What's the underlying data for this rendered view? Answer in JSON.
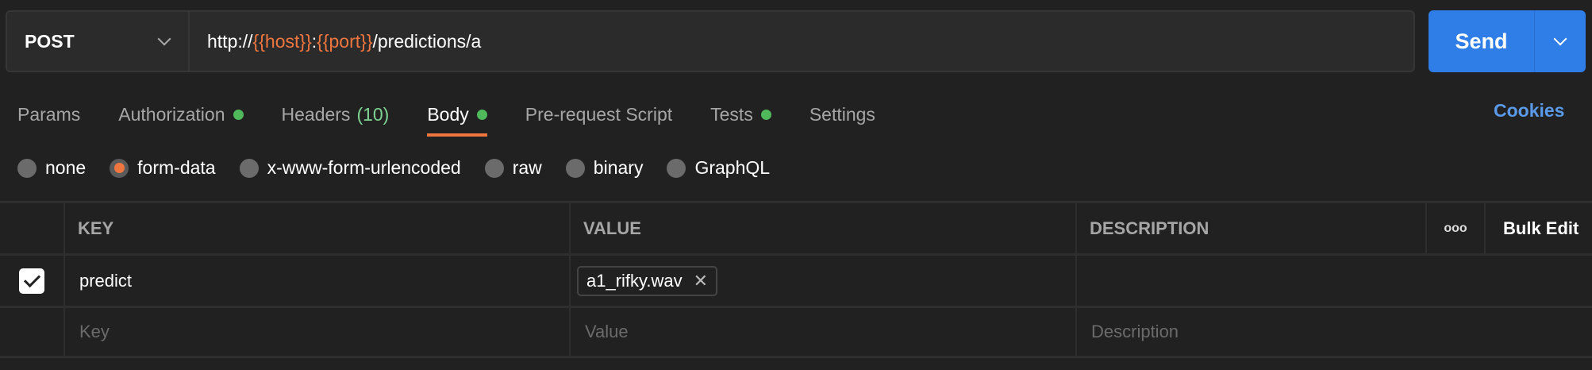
{
  "request": {
    "method": "POST",
    "url_parts": [
      {
        "t": "http://",
        "v": false
      },
      {
        "t": "{{host}}",
        "v": true
      },
      {
        "t": ":",
        "v": false
      },
      {
        "t": "{{port}}",
        "v": true
      },
      {
        "t": "/predictions/a",
        "v": false
      }
    ]
  },
  "send": {
    "label": "Send"
  },
  "tabs": [
    {
      "label": "Params"
    },
    {
      "label": "Authorization",
      "dot": true
    },
    {
      "label": "Headers",
      "count": "(10)"
    },
    {
      "label": "Body",
      "dot": true,
      "active": true
    },
    {
      "label": "Pre-request Script"
    },
    {
      "label": "Tests",
      "dot": true
    },
    {
      "label": "Settings"
    }
  ],
  "cookies": "Cookies",
  "body_types": [
    {
      "label": "none"
    },
    {
      "label": "form-data",
      "selected": true
    },
    {
      "label": "x-www-form-urlencoded"
    },
    {
      "label": "raw"
    },
    {
      "label": "binary"
    },
    {
      "label": "GraphQL"
    }
  ],
  "table": {
    "headers": {
      "key": "KEY",
      "value": "VALUE",
      "description": "DESCRIPTION",
      "more": "ooo",
      "bulk_edit": "Bulk Edit"
    },
    "rows": [
      {
        "checked": true,
        "key": "predict",
        "file": "a1_rifky.wav",
        "description": ""
      }
    ],
    "placeholders": {
      "key": "Key",
      "value": "Value",
      "description": "Description"
    }
  },
  "colors": {
    "accent": "#f0763f",
    "send": "#2f7de6",
    "dot": "#4fb95c",
    "link": "#5a9ae8"
  }
}
